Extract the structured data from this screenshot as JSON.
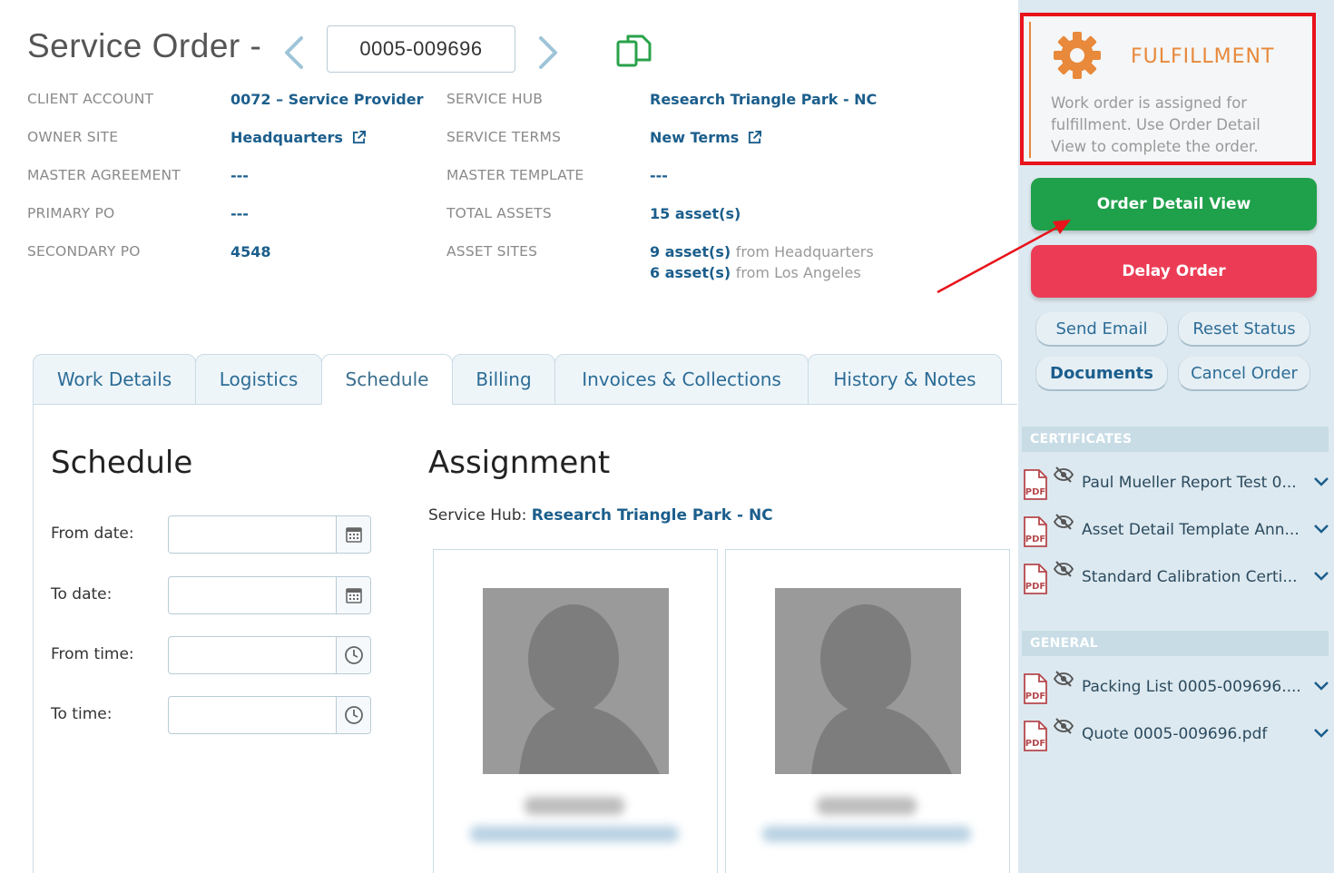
{
  "header": {
    "title": "Service Order -",
    "order_number": "0005-009696"
  },
  "info": {
    "client_account_label": "CLIENT ACCOUNT",
    "client_account_value": "0072 – Service Provider",
    "owner_site_label": "OWNER SITE",
    "owner_site_value": "Headquarters",
    "master_agreement_label": "MASTER AGREEMENT",
    "master_agreement_value": "---",
    "primary_po_label": "PRIMARY PO",
    "primary_po_value": "---",
    "secondary_po_label": "SECONDARY PO",
    "secondary_po_value": "4548",
    "service_hub_label": "SERVICE HUB",
    "service_hub_value": "Research Triangle Park - NC",
    "service_terms_label": "SERVICE TERMS",
    "service_terms_value": "New Terms",
    "master_template_label": "MASTER TEMPLATE",
    "master_template_value": "---",
    "total_assets_label": "TOTAL ASSETS",
    "total_assets_value": "15 asset(s)",
    "asset_sites_label": "ASSET SITES",
    "asset_sites_1_count": "9 asset(s)",
    "asset_sites_1_from": "from Headquarters",
    "asset_sites_2_count": "6 asset(s)",
    "asset_sites_2_from": "from Los Angeles"
  },
  "tabs": [
    "Work Details",
    "Logistics",
    "Schedule",
    "Billing",
    "Invoices & Collections",
    "History & Notes"
  ],
  "schedule": {
    "heading": "Schedule",
    "from_date": "From date:",
    "to_date": "To date:",
    "from_time": "From time:",
    "to_time": "To time:"
  },
  "assignment": {
    "heading": "Assignment",
    "hub_label": "Service Hub:",
    "hub_value": "Research Triangle Park - NC"
  },
  "sidebar": {
    "fulfillment_title": "FULFILLMENT",
    "fulfillment_text": "Work order is assigned for fulfillment. Use Order Detail View to complete the order.",
    "order_detail_view": "Order Detail View",
    "delay_order": "Delay Order",
    "send_email": "Send Email",
    "reset_status": "Reset Status",
    "documents": "Documents",
    "cancel_order": "Cancel Order",
    "certificates_label": "CERTIFICATES",
    "general_label": "GENERAL",
    "certificates": [
      "Paul Mueller Report Test 0...",
      "Asset Detail Template Ann...",
      "Standard Calibration Certi..."
    ],
    "general": [
      "Packing List 0005-009696....",
      "Quote 0005-009696.pdf"
    ]
  },
  "colors": {
    "link_blue": "#1b5e8c",
    "green": "#1fa04a",
    "red": "#ec3c55",
    "orange": "#e8893b",
    "highlight_red": "#e8131b"
  }
}
